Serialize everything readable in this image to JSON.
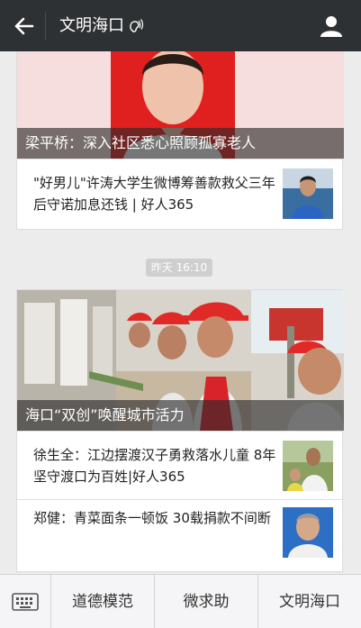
{
  "header": {
    "title": "文明海口"
  },
  "feed": {
    "card1": {
      "hero_caption": "梁平桥：深入社区悉心照顾孤寡老人",
      "items": [
        {
          "title": "\"好男儿\"许涛大学生微博筹善款救父三年后守诺加息还钱 | 好人365"
        }
      ]
    },
    "timestamp": "昨天 16:10",
    "card2": {
      "hero_caption": "海口“双创”唤醒城市活力",
      "items": [
        {
          "title": "徐生全：江边摆渡汉子勇救落水儿童 8年坚守渡口为百姓|好人365"
        },
        {
          "title": "郑健：青菜面条一顿饭 30载捐款不间断"
        }
      ]
    }
  },
  "bottom_menu": {
    "items": [
      "道德模范",
      "微求助",
      "文明海口"
    ]
  },
  "colors": {
    "topbar_bg": "#2e3133",
    "page_bg": "#ececec",
    "caption_overlay": "rgba(40,40,40,0.62)"
  }
}
